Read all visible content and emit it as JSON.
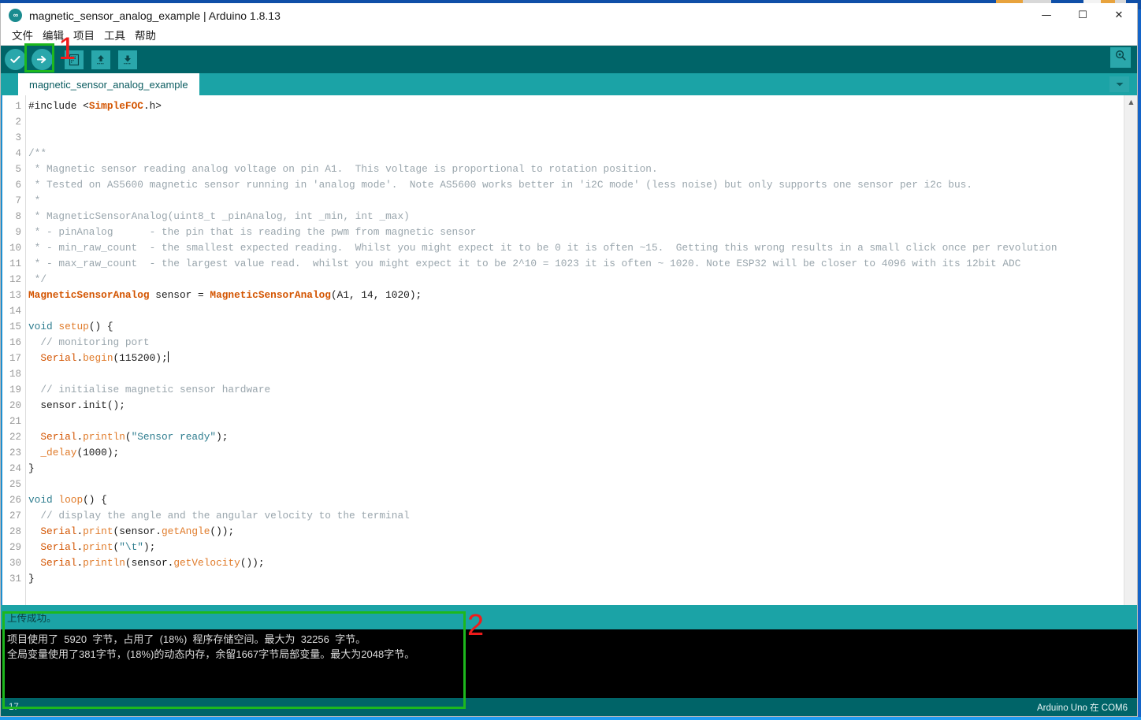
{
  "window": {
    "title": "magnetic_sensor_analog_example | Arduino 1.8.13",
    "app_icon": "arduino-infinity-icon",
    "minimize": "—",
    "maximize": "☐",
    "close": "✕"
  },
  "menubar": {
    "items": [
      {
        "label": "文件",
        "name": "menu-file"
      },
      {
        "label": "编辑",
        "name": "menu-edit"
      },
      {
        "label": "项目",
        "name": "menu-sketch"
      },
      {
        "label": "工具",
        "name": "menu-tools"
      },
      {
        "label": "帮助",
        "name": "menu-help"
      }
    ]
  },
  "toolbar": {
    "verify": "verify-icon",
    "upload": "upload-arrow-icon",
    "new": "new-file-icon",
    "open": "open-up-arrow-icon",
    "save": "save-down-arrow-icon",
    "serial_monitor": "serial-monitor-magnifier-icon"
  },
  "tabs": {
    "active": "magnetic_sensor_analog_example",
    "menu_icon": "chevron-down-icon"
  },
  "editor": {
    "line_numbers": [
      "1",
      "2",
      "3",
      "4",
      "5",
      "6",
      "7",
      "8",
      "9",
      "10",
      "11",
      "12",
      "13",
      "14",
      "15",
      "16",
      "17",
      "18",
      "19",
      "20",
      "21",
      "22",
      "23",
      "24",
      "25",
      "26",
      "27",
      "28",
      "29",
      "30",
      "31"
    ],
    "lines": [
      [
        {
          "t": "#include ",
          "c": "plain"
        },
        {
          "t": "<",
          "c": "plain"
        },
        {
          "t": "SimpleFOC",
          "c": "type"
        },
        {
          "t": ".h>",
          "c": "plain"
        }
      ],
      [],
      [],
      [
        {
          "t": "/**",
          "c": "comment"
        }
      ],
      [
        {
          "t": " * Magnetic sensor reading analog voltage on pin A1.  This voltage is proportional to rotation position.",
          "c": "comment"
        }
      ],
      [
        {
          "t": " * Tested on AS5600 magnetic sensor running in 'analog mode'.  Note AS5600 works better in 'i2C mode' (less noise) but only supports one sensor per i2c bus.",
          "c": "comment"
        }
      ],
      [
        {
          "t": " *",
          "c": "comment"
        }
      ],
      [
        {
          "t": " * MagneticSensorAnalog(uint8_t _pinAnalog, int _min, int _max)",
          "c": "comment"
        }
      ],
      [
        {
          "t": " * - pinAnalog      - the pin that is reading the pwm from magnetic sensor",
          "c": "comment"
        }
      ],
      [
        {
          "t": " * - min_raw_count  - the smallest expected reading.  Whilst you might expect it to be 0 it is often ~15.  Getting this wrong results in a small click once per revolution",
          "c": "comment"
        }
      ],
      [
        {
          "t": " * - max_raw_count  - the largest value read.  whilst you might expect it to be 2^10 = 1023 it is often ~ 1020. Note ESP32 will be closer to 4096 with its 12bit ADC",
          "c": "comment"
        }
      ],
      [
        {
          "t": " */",
          "c": "comment"
        }
      ],
      [
        {
          "t": "MagneticSensorAnalog",
          "c": "type"
        },
        {
          "t": " sensor = ",
          "c": "plain"
        },
        {
          "t": "MagneticSensorAnalog",
          "c": "type"
        },
        {
          "t": "(A1, 14, 1020);",
          "c": "plain"
        }
      ],
      [],
      [
        {
          "t": "void",
          "c": "kw"
        },
        {
          "t": " ",
          "c": "plain"
        },
        {
          "t": "setup",
          "c": "fn2"
        },
        {
          "t": "() {",
          "c": "plain"
        }
      ],
      [
        {
          "t": "  // monitoring port",
          "c": "comment"
        }
      ],
      [
        {
          "t": "  ",
          "c": "plain"
        },
        {
          "t": "Serial",
          "c": "fn"
        },
        {
          "t": ".",
          "c": "plain"
        },
        {
          "t": "begin",
          "c": "fn2"
        },
        {
          "t": "(115200);",
          "c": "plain"
        },
        {
          "t": "CARET",
          "c": "caret"
        }
      ],
      [],
      [
        {
          "t": "  // initialise magnetic sensor hardware",
          "c": "comment"
        }
      ],
      [
        {
          "t": "  sensor.init();",
          "c": "plain"
        }
      ],
      [],
      [
        {
          "t": "  ",
          "c": "plain"
        },
        {
          "t": "Serial",
          "c": "fn"
        },
        {
          "t": ".",
          "c": "plain"
        },
        {
          "t": "println",
          "c": "fn2"
        },
        {
          "t": "(",
          "c": "plain"
        },
        {
          "t": "\"Sensor ready\"",
          "c": "str"
        },
        {
          "t": ");",
          "c": "plain"
        }
      ],
      [
        {
          "t": "  ",
          "c": "plain"
        },
        {
          "t": "_delay",
          "c": "fn2"
        },
        {
          "t": "(1000);",
          "c": "plain"
        }
      ],
      [
        {
          "t": "}",
          "c": "plain"
        }
      ],
      [],
      [
        {
          "t": "void",
          "c": "kw"
        },
        {
          "t": " ",
          "c": "plain"
        },
        {
          "t": "loop",
          "c": "fn2"
        },
        {
          "t": "() {",
          "c": "plain"
        }
      ],
      [
        {
          "t": "  // display the angle and the angular velocity to the terminal",
          "c": "comment"
        }
      ],
      [
        {
          "t": "  ",
          "c": "plain"
        },
        {
          "t": "Serial",
          "c": "fn"
        },
        {
          "t": ".",
          "c": "plain"
        },
        {
          "t": "print",
          "c": "fn2"
        },
        {
          "t": "(sensor.",
          "c": "plain"
        },
        {
          "t": "getAngle",
          "c": "fn2"
        },
        {
          "t": "());",
          "c": "plain"
        }
      ],
      [
        {
          "t": "  ",
          "c": "plain"
        },
        {
          "t": "Serial",
          "c": "fn"
        },
        {
          "t": ".",
          "c": "plain"
        },
        {
          "t": "print",
          "c": "fn2"
        },
        {
          "t": "(",
          "c": "plain"
        },
        {
          "t": "\"\\t\"",
          "c": "str"
        },
        {
          "t": ");",
          "c": "plain"
        }
      ],
      [
        {
          "t": "  ",
          "c": "plain"
        },
        {
          "t": "Serial",
          "c": "fn"
        },
        {
          "t": ".",
          "c": "plain"
        },
        {
          "t": "println",
          "c": "fn2"
        },
        {
          "t": "(sensor.",
          "c": "plain"
        },
        {
          "t": "getVelocity",
          "c": "fn2"
        },
        {
          "t": "());",
          "c": "plain"
        }
      ],
      [
        {
          "t": "}",
          "c": "plain"
        }
      ]
    ],
    "scrollbar": {
      "up_arrow": "▲",
      "down_arrow": "▼"
    }
  },
  "status": {
    "message": "上传成功。"
  },
  "console": {
    "lines": [
      "项目使用了  5920  字节，占用了  (18%)  程序存储空间。最大为  32256  字节。",
      "全局变量使用了381字节，(18%)的动态内存，余留1667字节局部变量。最大为2048字节。"
    ]
  },
  "statusbar": {
    "line_indicator": "17",
    "board": "Arduino Uno 在 COM6"
  },
  "annotations": {
    "marker_1": "1",
    "marker_2": "2",
    "box_color": "#1db81d",
    "number_color": "#f11b1b"
  }
}
